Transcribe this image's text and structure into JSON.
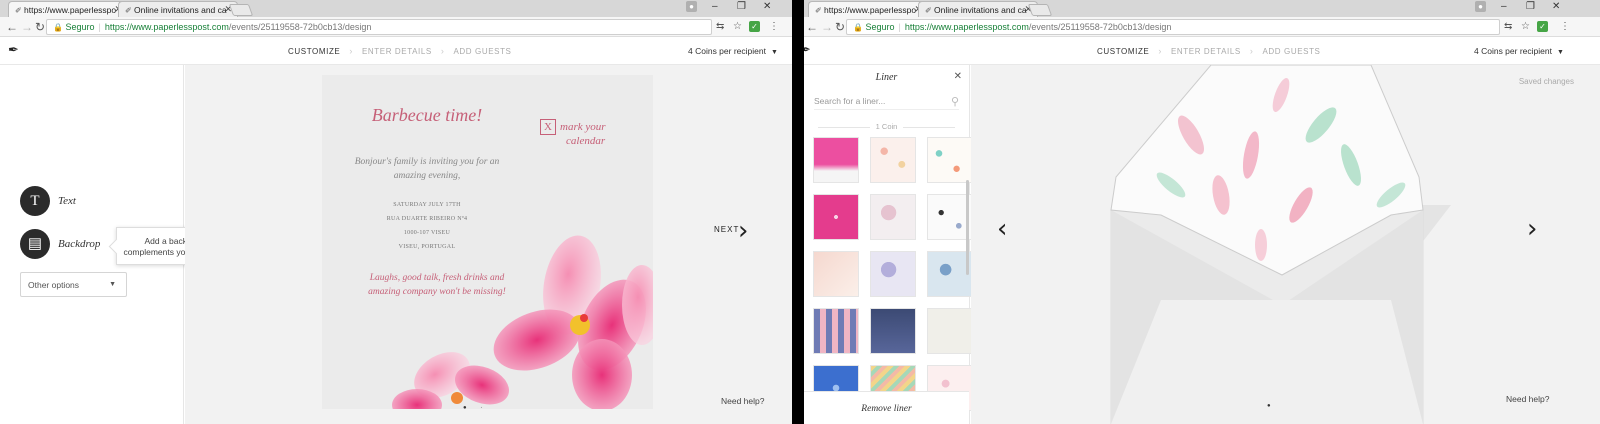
{
  "left": {
    "tabs": [
      {
        "label": "https://www.paperlesspo"
      },
      {
        "label": "Online invitations and ca"
      }
    ],
    "address": {
      "secure": "Seguro",
      "host": "https://www.paperlesspost.com",
      "path": "/events/25119558-72b0cb13/design"
    },
    "steps": [
      "CUSTOMIZE",
      "ENTER DETAILS",
      "ADD GUESTS"
    ],
    "coins": "4 Coins per recipient",
    "tools": [
      {
        "label": "Text",
        "glyph": "T"
      },
      {
        "label": "Backdrop",
        "glyph": "▤"
      }
    ],
    "tooltip": [
      "Add a backdrop that",
      "complements your card design."
    ],
    "other_options": "Other options",
    "card": {
      "title": "Barbecue time!",
      "intro": [
        "Bonjour's family is inviting you for an",
        "amazing evening,"
      ],
      "details": [
        "SATURDAY JULY 17TH",
        "RUA DUARTE RIBEIRO Nº4",
        "1000-107 VISEU",
        "VISEU, PORTUGAL"
      ],
      "closing": [
        "Laughs, good talk, fresh drinks and",
        "amazing company won't be missing!"
      ],
      "calendar": [
        "mark your",
        "calendar"
      ],
      "calendar_box": "X"
    },
    "next": "NEXT",
    "help": "Need help?"
  },
  "right": {
    "tabs": [
      {
        "label": "https://www.paperlesspo"
      },
      {
        "label": "Online invitations and ca"
      }
    ],
    "address": {
      "secure": "Seguro",
      "host": "https://www.paperlesspost.com",
      "path": "/events/25119558-72b0cb13/design"
    },
    "steps": [
      "CUSTOMIZE",
      "ENTER DETAILS",
      "ADD GUESTS"
    ],
    "coins": "4 Coins per recipient",
    "liner": {
      "title": "Liner",
      "search_placeholder": "Search for a liner...",
      "coin_label": "1 Coin",
      "remove": "Remove liner"
    },
    "saved": "Saved changes",
    "help": "Need help?"
  }
}
